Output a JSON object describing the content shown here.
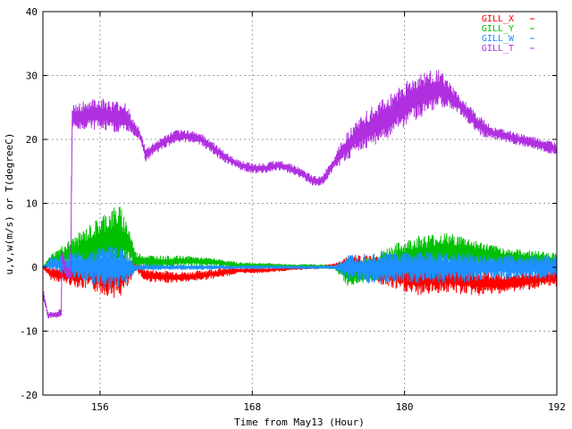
{
  "chart_data": {
    "type": "line",
    "xlabel": "Time from May13 (Hour)",
    "ylabel": "u,v,w(m/s) or T(degreeC)",
    "xlim": [
      151.5,
      192
    ],
    "ylim": [
      -20,
      40
    ],
    "xticks": [
      156,
      168,
      180,
      192
    ],
    "yticks": [
      -20,
      -10,
      0,
      10,
      20,
      30,
      40
    ],
    "grid": true,
    "legend_position": "top-right",
    "series": [
      {
        "name": "GILL_X",
        "color": "#ff0000",
        "x": [
          151.5,
          152.1,
          155.7,
          156.5,
          157.5,
          158.3,
          158.8,
          159.5,
          161,
          163,
          165,
          167,
          169,
          171,
          173,
          174.5,
          175.5,
          177,
          179,
          181,
          183,
          184.5,
          186,
          188,
          190,
          192
        ],
        "y": [
          0,
          -1,
          -1,
          -1,
          -1,
          -1,
          0.5,
          -1.2,
          -1.5,
          -1.5,
          -1,
          -0.5,
          -0.5,
          -0.2,
          0,
          0.3,
          0.2,
          0,
          -1,
          -2,
          -1.5,
          -1.8,
          -2.5,
          -2.5,
          -2,
          -1.5
        ],
        "spread": [
          0,
          1,
          3,
          3.5,
          4,
          2,
          1,
          1,
          1,
          0.8,
          0.8,
          0.5,
          0.4,
          0.3,
          0.3,
          0.3,
          1.5,
          2,
          2.5,
          2.5,
          2.5,
          2.5,
          2,
          1.5,
          1.5,
          1.5
        ]
      },
      {
        "name": "GILL_Y",
        "color": "#00c000",
        "x": [
          151.5,
          152.1,
          155.7,
          156.5,
          157.5,
          158.3,
          158.8,
          159.5,
          161,
          163,
          165,
          167,
          169,
          171,
          173,
          174.5,
          175.5,
          177,
          179,
          181,
          183,
          184.5,
          186,
          188,
          190,
          192
        ],
        "y": [
          0,
          1,
          3.5,
          4,
          4.5,
          3.5,
          1,
          1,
          0.8,
          1,
          0.8,
          0.3,
          0.3,
          0.2,
          0.2,
          0,
          -1,
          -0.5,
          1,
          2,
          2.5,
          2.5,
          2,
          1.5,
          1.2,
          0.8
        ],
        "spread": [
          0,
          1,
          4,
          5,
          5.5,
          3,
          1.5,
          1,
          1,
          0.8,
          0.6,
          0.5,
          0.4,
          0.3,
          0.3,
          0.3,
          2,
          2,
          2.5,
          3,
          3,
          2.5,
          2,
          1.5,
          1.5,
          1.5
        ]
      },
      {
        "name": "GILL_W",
        "color": "#1e90ff",
        "x": [
          151.5,
          152.1,
          155.7,
          156.5,
          157.5,
          158.3,
          158.8,
          159.5,
          161,
          163,
          165,
          167,
          169,
          171,
          173,
          174.5,
          175.5,
          177,
          179,
          181,
          183,
          184.5,
          186,
          188,
          190,
          192
        ],
        "y": [
          0,
          0.5,
          0,
          0,
          0,
          0,
          0,
          0,
          0,
          0,
          0,
          0,
          0,
          0,
          0,
          0,
          0,
          0,
          0,
          0,
          0,
          0,
          0,
          0,
          0,
          0
        ],
        "spread": [
          0,
          1,
          3,
          3.5,
          3.5,
          2.5,
          0.5,
          0.5,
          0.4,
          0.4,
          0.4,
          0.3,
          0.3,
          0.3,
          0.3,
          0.3,
          2,
          2.5,
          2.5,
          2.5,
          2.5,
          2.5,
          2,
          2,
          2,
          2
        ]
      },
      {
        "name": "GILL_T",
        "color": "#b030e0",
        "x": [
          151.5,
          151.9,
          152.1,
          152.5,
          153.0,
          153.0,
          153.4,
          153.7,
          153.8,
          155.7,
          156,
          157,
          158,
          158.8,
          159.1,
          159.6,
          160.2,
          161,
          162,
          163,
          164,
          165,
          166,
          167,
          168,
          169,
          170,
          171,
          172,
          172.8,
          173.5,
          174,
          174.5,
          175,
          176,
          177,
          178,
          179,
          180,
          181,
          182,
          182.8,
          183.5,
          184.3,
          185,
          186,
          187,
          188,
          189,
          190,
          191,
          192
        ],
        "y": [
          -4,
          -7.5,
          -7.5,
          -7.5,
          -7,
          2,
          -1,
          -1,
          23.5,
          24,
          24,
          23.5,
          23.5,
          21.5,
          21,
          17.5,
          18.5,
          19.5,
          20.5,
          20.5,
          20,
          18.5,
          17,
          16,
          15.5,
          15.5,
          16,
          15.5,
          14.5,
          13.5,
          13.5,
          15,
          16.5,
          18,
          20,
          21.5,
          22.5,
          24,
          25.5,
          26.5,
          27.5,
          28,
          27,
          25.5,
          24,
          22,
          21,
          20.5,
          20,
          19.5,
          19,
          18.5
        ],
        "spread": [
          1,
          0.5,
          0.5,
          0.5,
          1,
          1,
          1,
          1,
          2,
          2.5,
          2.5,
          2.5,
          2.5,
          1,
          1,
          1,
          1,
          1,
          1,
          1,
          1,
          1,
          0.8,
          0.8,
          0.8,
          0.8,
          0.8,
          0.8,
          0.8,
          0.8,
          0.8,
          1,
          1,
          2,
          2.5,
          3,
          3.5,
          3.5,
          3.5,
          3.5,
          3.5,
          3,
          2,
          1.5,
          1.5,
          1.5,
          1,
          1,
          1,
          1,
          1,
          1
        ]
      }
    ]
  }
}
